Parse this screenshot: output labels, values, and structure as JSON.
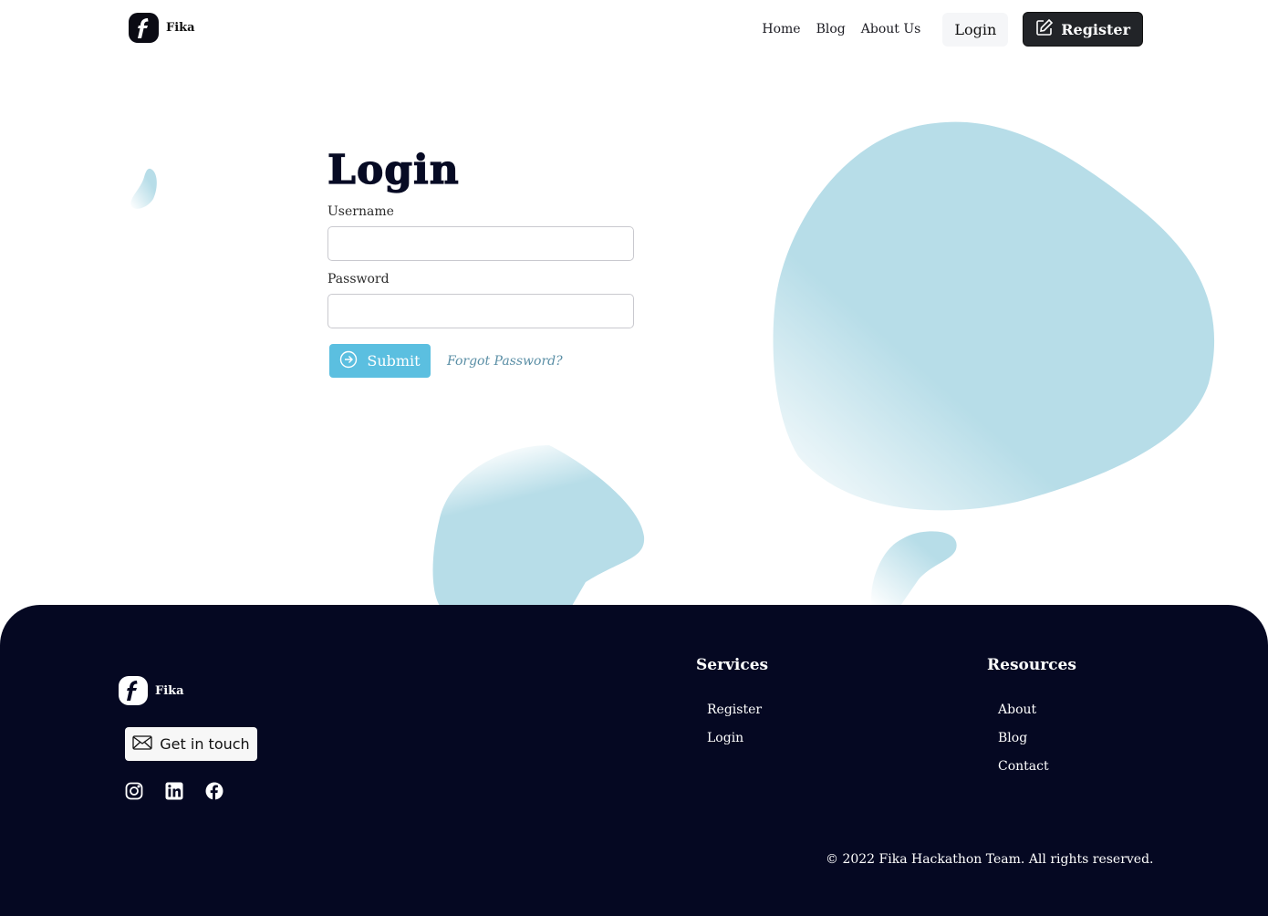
{
  "brand": {
    "name": "Fika"
  },
  "nav": {
    "items": [
      "Home",
      "Blog",
      "About Us"
    ],
    "login_label": "Login",
    "register_label": "Register"
  },
  "login": {
    "title": "Login",
    "username_label": "Username",
    "username_value": "",
    "password_label": "Password",
    "password_value": "",
    "submit_label": "Submit",
    "forgot_label": "Forgot Password?"
  },
  "footer": {
    "brand_name": "Fika",
    "contact_label": "Get in touch",
    "social_icons": [
      "instagram-icon",
      "linkedin-icon",
      "facebook-icon"
    ],
    "services": {
      "title": "Services",
      "items": [
        "Register",
        "Login"
      ]
    },
    "resources": {
      "title": "Resources",
      "items": [
        "About",
        "Blog",
        "Contact"
      ]
    },
    "copyright": "© 2022 Fika Hackathon Team. All rights reserved."
  },
  "colors": {
    "accent": "#5bbfe0",
    "blob": "#b7dde8",
    "footer_bg": "#050822",
    "dark_button": "#222428"
  }
}
